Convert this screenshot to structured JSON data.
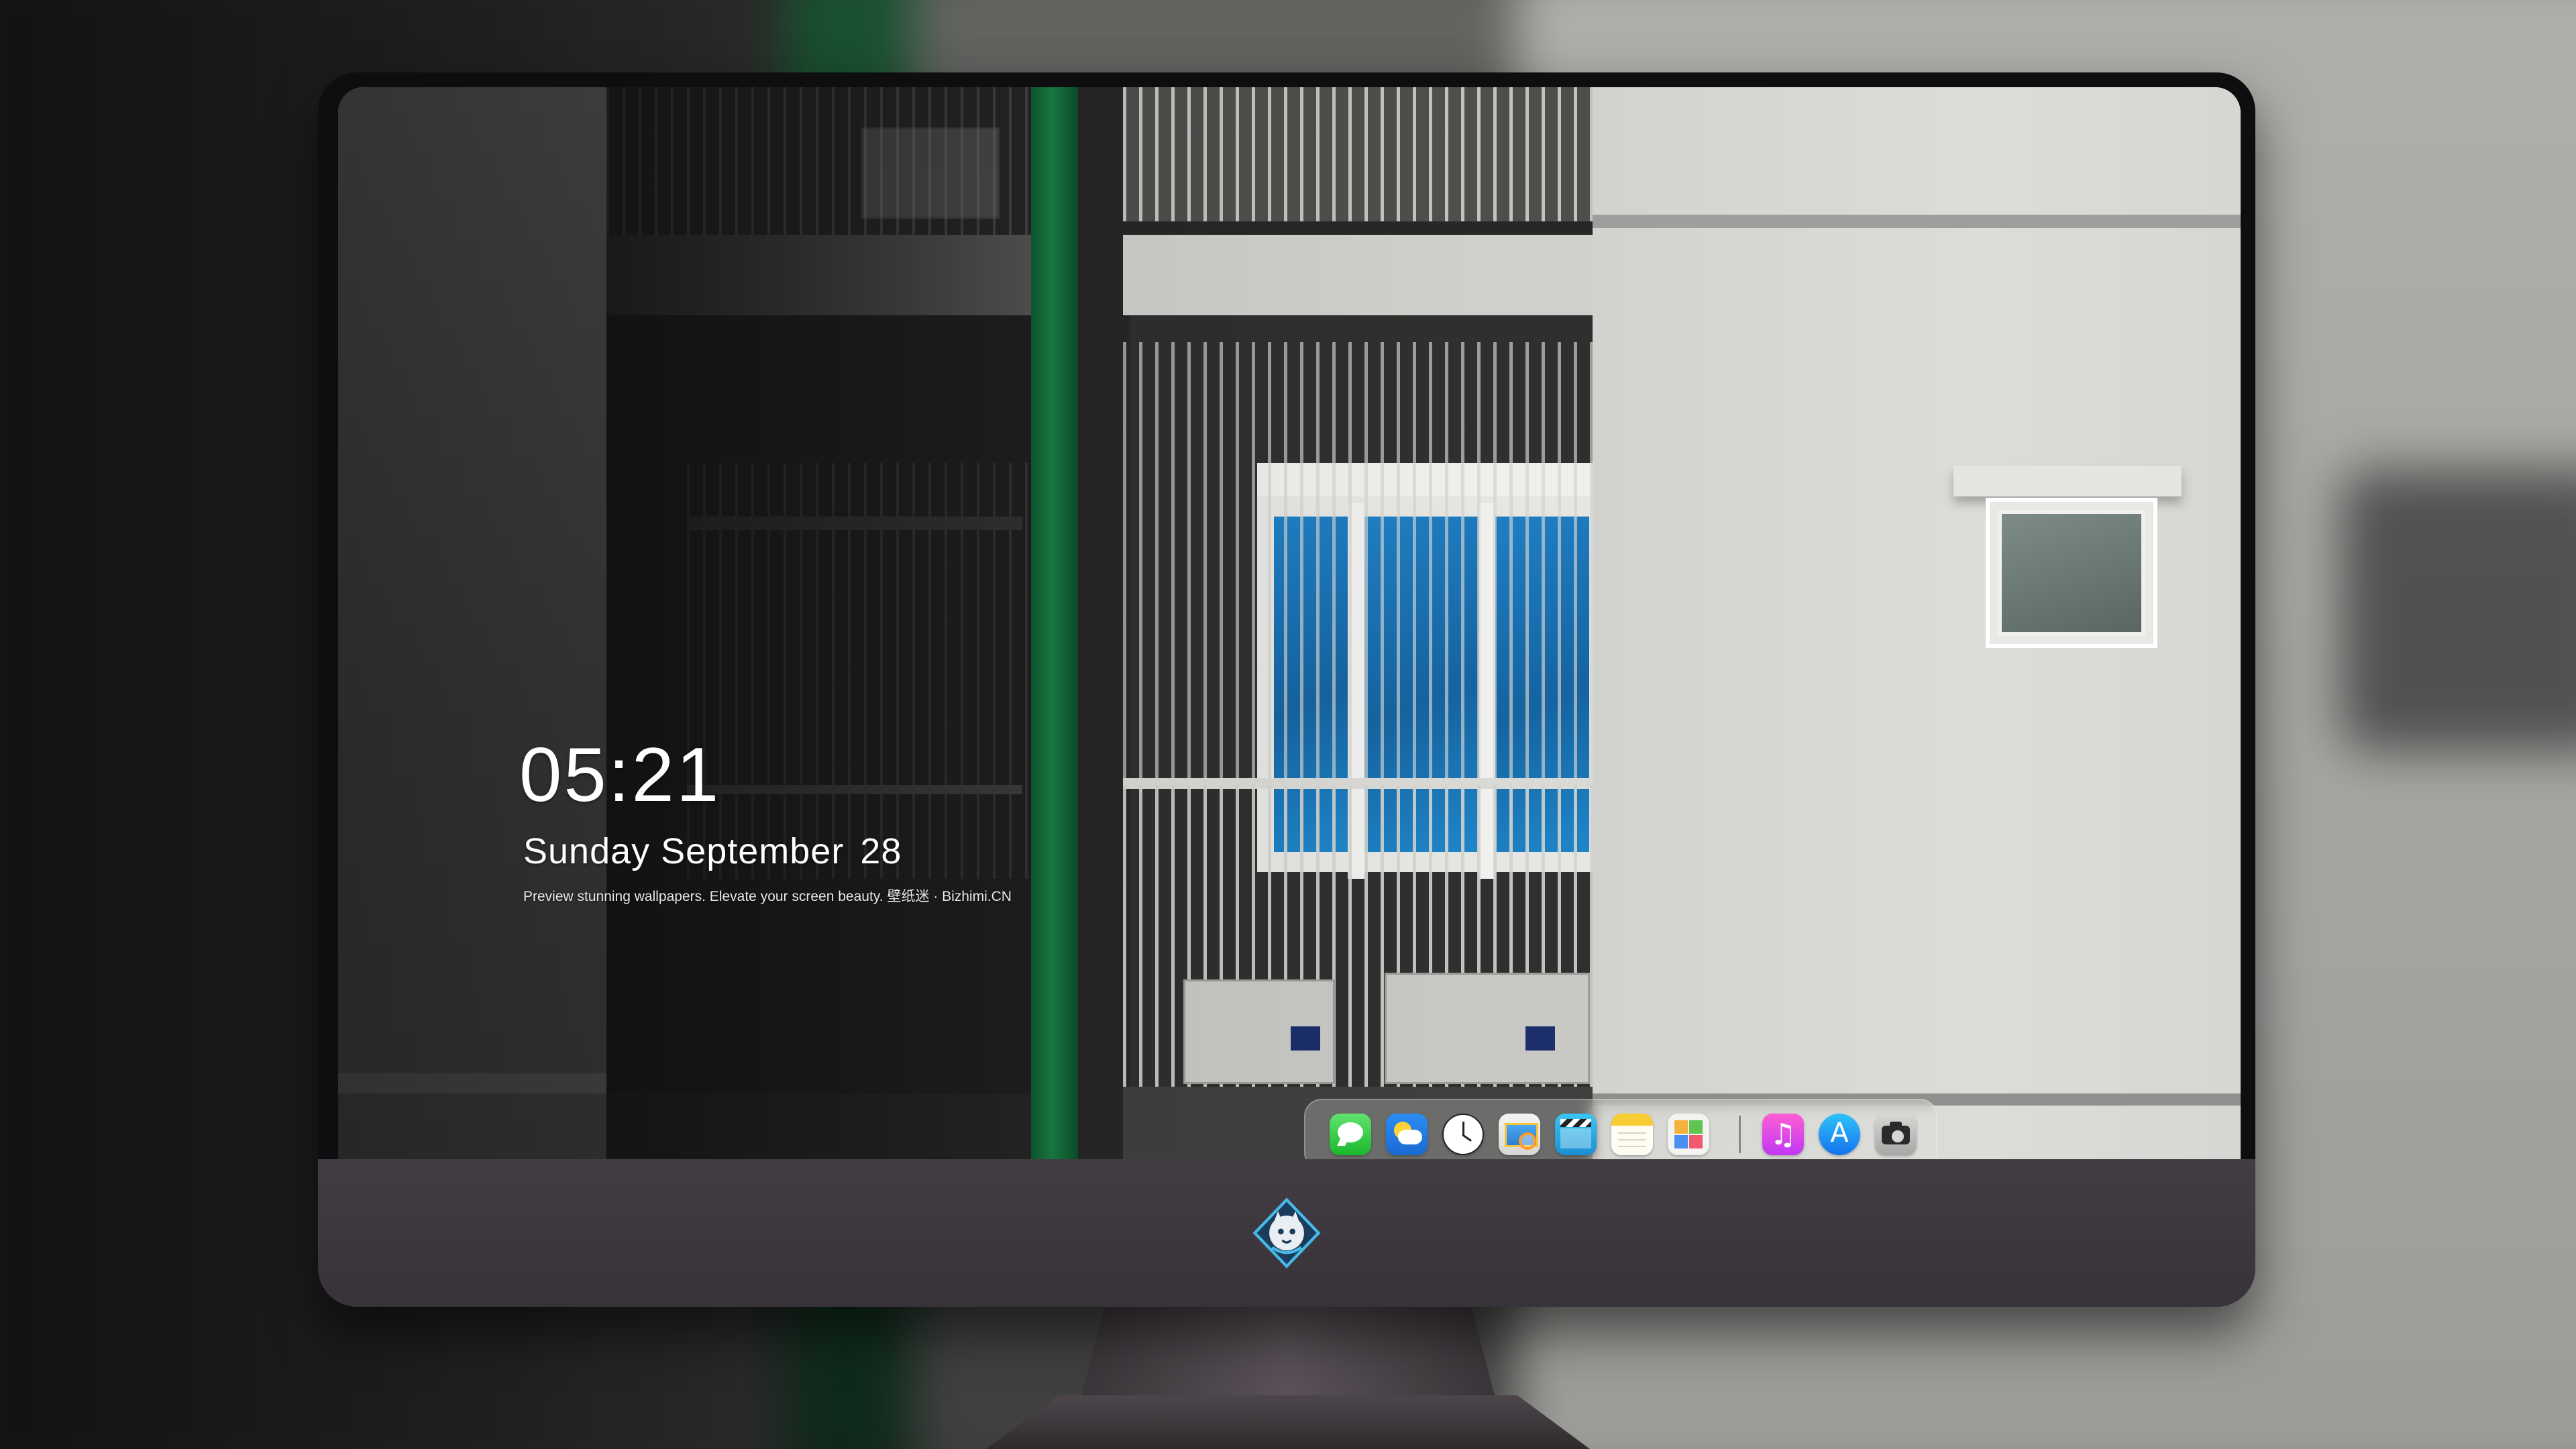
{
  "lock_screen": {
    "time": "05:21",
    "date_label": "Sunday September",
    "day_number": "28",
    "tagline": "Preview stunning wallpapers. Elevate your screen beauty. 壁纸迷 · Bizhimi.CN"
  },
  "dock": {
    "apps": [
      {
        "name": "Messages",
        "icon": "messages-icon"
      },
      {
        "name": "Weather",
        "icon": "weather-icon"
      },
      {
        "name": "Clock",
        "icon": "clock-icon"
      },
      {
        "name": "Preview",
        "icon": "preview-icon"
      },
      {
        "name": "Clips",
        "icon": "clapperboard-icon"
      },
      {
        "name": "Notes",
        "icon": "notes-icon"
      },
      {
        "name": "Photos",
        "icon": "photos-icon"
      },
      {
        "name": "Music",
        "icon": "music-icon",
        "glyph": "♫"
      },
      {
        "name": "App Store",
        "icon": "app-store-icon",
        "glyph": "A"
      },
      {
        "name": "Camera",
        "icon": "camera-icon"
      }
    ]
  },
  "brand": {
    "icon": "mascot-logo-icon"
  },
  "colors": {
    "accent_green": "#1a7e45",
    "monitor_chin": "#3d373e",
    "dock_glass": "rgba(225,225,222,0.28)"
  }
}
